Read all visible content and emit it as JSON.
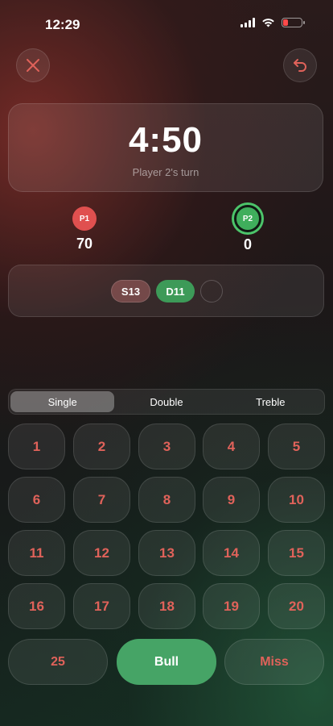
{
  "status_bar": {
    "time": "12:29"
  },
  "timer": {
    "value": "4:50",
    "turn_label": "Player 2's turn"
  },
  "players": [
    {
      "badge": "P1",
      "score": "70",
      "color": "#e0504f"
    },
    {
      "badge": "P2",
      "score": "0",
      "color": "#3fae5c",
      "active": true
    }
  ],
  "throws": [
    "S13",
    "D11"
  ],
  "multiplier": {
    "options": [
      "Single",
      "Double",
      "Treble"
    ],
    "selected": "Single"
  },
  "numbers": [
    "1",
    "2",
    "3",
    "4",
    "5",
    "6",
    "7",
    "8",
    "9",
    "10",
    "11",
    "12",
    "13",
    "14",
    "15",
    "16",
    "17",
    "18",
    "19",
    "20"
  ],
  "bottom_buttons": {
    "twenty_five": "25",
    "bull": "Bull",
    "miss": "Miss"
  },
  "colors": {
    "accent_red": "#e0625a",
    "accent_green": "#46a466"
  }
}
